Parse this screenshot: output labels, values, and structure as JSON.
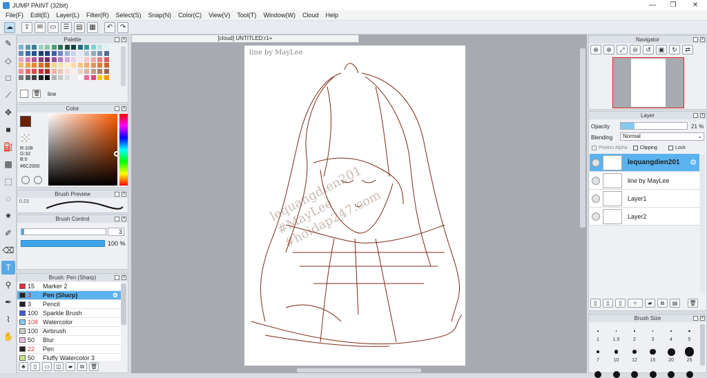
{
  "window": {
    "title": "JUMP PAINT (32bit)"
  },
  "menu": [
    "File(F)",
    "Edit(E)",
    "Layer(L)",
    "Filter(R)",
    "Select(S)",
    "Snap(N)",
    "Color(C)",
    "View(V)",
    "Tool(T)",
    "Window(W)",
    "Cloud",
    "Help"
  ],
  "palette": {
    "title": "Palette",
    "set_name": "line",
    "colors": [
      "#7fb6c9",
      "#5e9aa9",
      "#3d7f8f",
      "#9ed1c2",
      "#8ec8a6",
      "#4d9e7a",
      "#2d6e57",
      "#1d4c3d",
      "#0e3e3f",
      "#1b6e77",
      "#3a9aa3",
      "#7fd1d6",
      "#b9e3e2",
      "#dcf1ef",
      "#5f89b6",
      "#3b6ea1",
      "#24558a",
      "#1b3d6a",
      "#233f8a",
      "#3d5ea8",
      "#6f86c1",
      "#9fb2da",
      "#c9d4ec",
      "#e1e8f5",
      "#b6c8da",
      "#90a9c1",
      "#7391ad",
      "#506e8d",
      "#e4a7c7",
      "#d07fb0",
      "#b05a95",
      "#8a3d7a",
      "#6e2f6a",
      "#9a4ea4",
      "#b57ec2",
      "#d2a9db",
      "#e7d0ec",
      "#f3e6f5",
      "#f5c7c9",
      "#f0a7aa",
      "#e47f84",
      "#d45a63",
      "#f2b86a",
      "#eea14a",
      "#e38a2f",
      "#d7721f",
      "#c35b19",
      "#f0d48a",
      "#f5e3ad",
      "#fff0c8",
      "#ffd9a8",
      "#f7c28a",
      "#f0ab6d",
      "#e89455",
      "#e07d3e",
      "#c8672f",
      "#f18d8d",
      "#e86a6a",
      "#d84b4b",
      "#c13535",
      "#a62828",
      "#f4b0a0",
      "#f0c4b4",
      "#f9dcd1",
      "#fdeee9",
      "#e8d2c7",
      "#d4b5a6",
      "#c39886",
      "#b07d69",
      "#9a6350",
      "#7d7d7d",
      "#5f5f5f",
      "#3f3f3f",
      "#1f1f1f",
      "#000000",
      "#b0b0b0",
      "#c8c8c8",
      "#dddddd",
      "#eeeeee",
      "#ffffff",
      "#f06a9b",
      "#e0457c",
      "#ffcc00",
      "#ff9900"
    ]
  },
  "color": {
    "title": "Color",
    "r": "R:108",
    "g": "G:32",
    "b": "B:0",
    "hex": "#6C2000",
    "current": "#6c2000"
  },
  "brush_preview": {
    "title": "Brush Preview",
    "size_label": "0.23"
  },
  "brush_control": {
    "title": "Brush Control",
    "size": "3",
    "opacity": "100 %"
  },
  "brush_list": {
    "title": "Brush: Pen (Sharp)",
    "items": [
      {
        "num": "15",
        "name": "Marker 2",
        "color": "#e0303a"
      },
      {
        "num": "3",
        "name": "Pen (Sharp)",
        "color": "#222222"
      },
      {
        "num": "3",
        "name": "Pencil",
        "color": "#222222"
      },
      {
        "num": "100",
        "name": "Sparkle Brush",
        "color": "#3d5bd6"
      },
      {
        "num": "108",
        "name": "Watercolor",
        "color": "#7fd1f0"
      },
      {
        "num": "100",
        "name": "Airbrush",
        "color": "#c9d2c4"
      },
      {
        "num": "50",
        "name": "Blur",
        "color": "#f5b8e8"
      },
      {
        "num": "22",
        "name": "Pen",
        "color": "#222222"
      },
      {
        "num": "50",
        "name": "Fluffy Watercolor 3",
        "color": "#c8e88a"
      }
    ]
  },
  "document": {
    "tab": "[cloud] UNTITLED:r1+",
    "watermark": "line by MayLee",
    "overlay": [
      "lequangdien201",
      "#MayLee",
      "#hoidap247.com"
    ]
  },
  "navigator": {
    "title": "Navigator"
  },
  "layer": {
    "title": "Layer",
    "opacity_label": "Opacity",
    "opacity_value": "21 %",
    "opacity_fraction": 0.21,
    "blending_label": "Blending",
    "blending_value": "Normal",
    "protect_alpha": "Protect Alpha",
    "clipping": "Clipping",
    "lock": "Lock",
    "layers": [
      {
        "name": "lequangdien201",
        "selected": true
      },
      {
        "name": "line by MayLee",
        "selected": false
      },
      {
        "name": "Layer1",
        "selected": false
      },
      {
        "name": "Layer2",
        "selected": false
      }
    ]
  },
  "brush_size": {
    "title": "Brush Size",
    "row1": [
      "1",
      "1.5",
      "2",
      "3",
      "4",
      "5"
    ],
    "row2": [
      "7",
      "10",
      "12",
      "15",
      "20",
      "25"
    ]
  }
}
